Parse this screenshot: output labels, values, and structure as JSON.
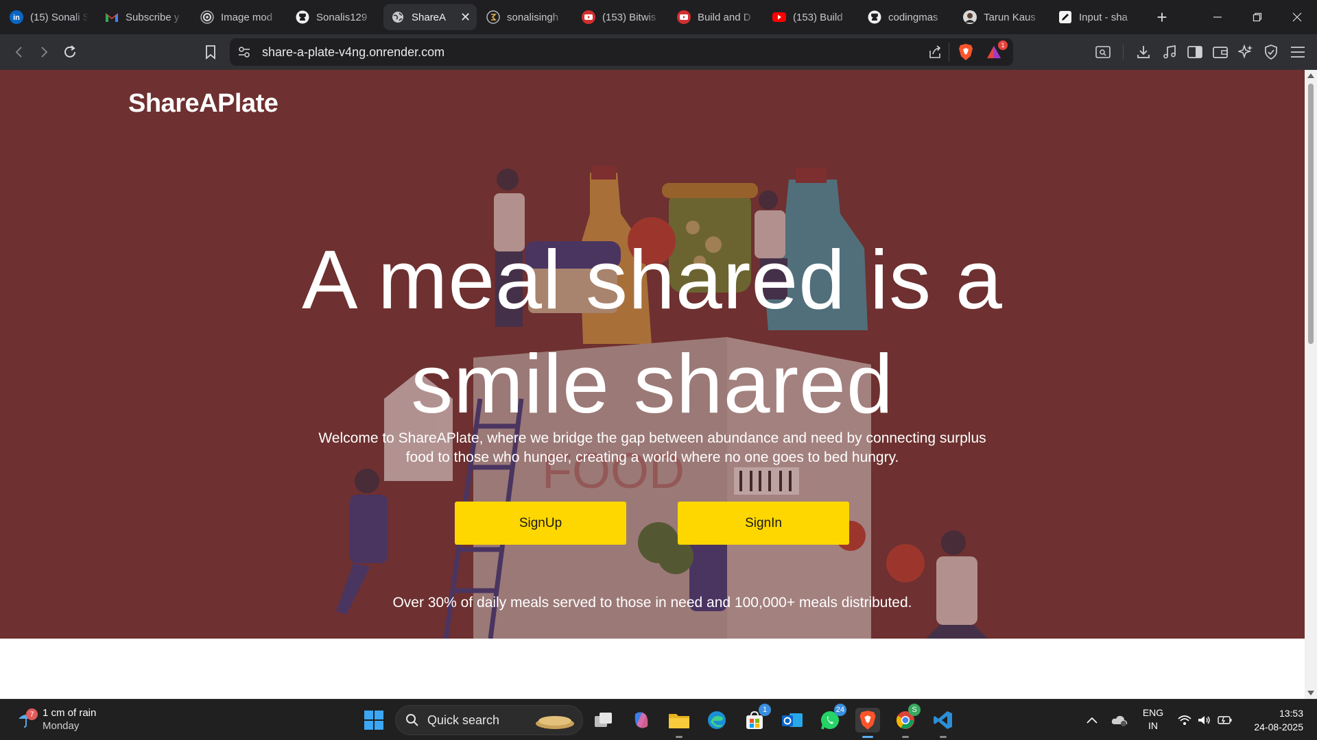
{
  "browser": {
    "tabs": [
      {
        "title": "(15) Sonali S",
        "icon": "linkedin-icon"
      },
      {
        "title": "Subscribe y",
        "icon": "gmail-icon"
      },
      {
        "title": "Image mod",
        "icon": "openai-icon"
      },
      {
        "title": "Sonalis129",
        "icon": "github-icon"
      },
      {
        "title": "ShareA",
        "icon": "globe-icon",
        "active": true
      },
      {
        "title": "sonalisingh",
        "icon": "site-icon"
      },
      {
        "title": "(153) Bitwis",
        "icon": "youtube-icon"
      },
      {
        "title": "Build and D",
        "icon": "youtube-icon"
      },
      {
        "title": "(153) Build",
        "icon": "youtube-icon"
      },
      {
        "title": "codingmas",
        "icon": "github-icon"
      },
      {
        "title": "Tarun Kaus",
        "icon": "avatar-icon"
      },
      {
        "title": "Input - sha",
        "icon": "pen-icon"
      }
    ],
    "url": "share-a-plate-v4ng.onrender.com",
    "brave_rewards_badge": "1"
  },
  "page": {
    "brand": "ShareAPlate",
    "headline_line1": "A meal shared is a",
    "headline_line2": "smile shared",
    "subtext": "Welcome to ShareAPlate, where we bridge the gap between abundance and need by connecting surplus food to those who hunger, creating a world where no one goes to bed hungry.",
    "signup_label": "SignUp",
    "signin_label": "SignIn",
    "stat_line": "Over 30% of daily meals served to those in need and 100,000+ meals distributed.",
    "colors": {
      "hero_bg": "#6e3030",
      "button": "#ffd700"
    }
  },
  "taskbar": {
    "weather_main": "1 cm of rain",
    "weather_sub": "Monday",
    "weather_badge": "7",
    "search_placeholder": "Quick search",
    "store_badge": "1",
    "whatsapp_badge": "24",
    "chrome_badge": "S",
    "lang_top": "ENG",
    "lang_bottom": "IN",
    "time": "13:53",
    "date": "24-08-2025"
  }
}
